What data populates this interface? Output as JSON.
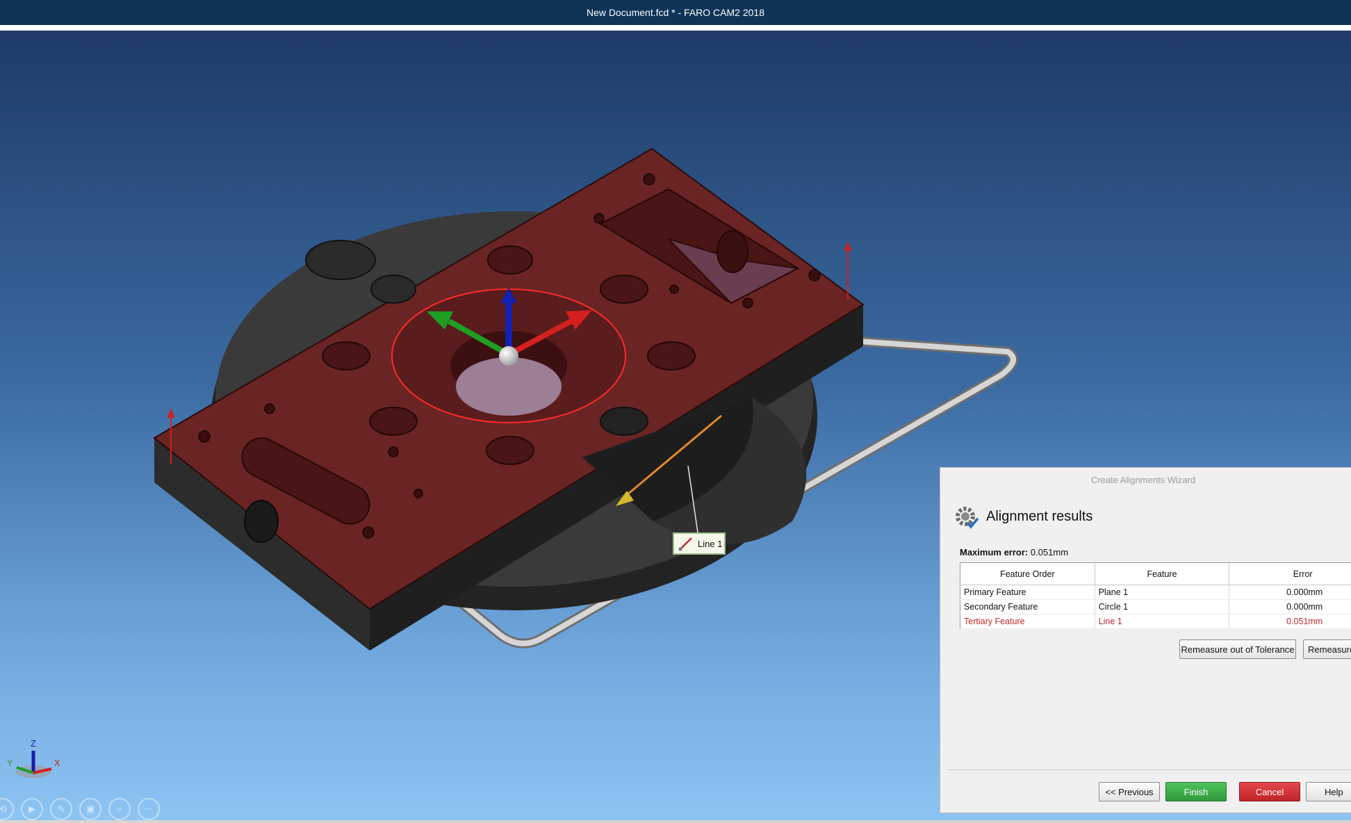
{
  "window": {
    "title": "New Document.fcd * - FARO CAM2 2018"
  },
  "viewport": {
    "feature_callout": {
      "label": "Line 1",
      "icon": "line-feature-icon"
    },
    "axis_triad": {
      "z": "Z",
      "y": "Y",
      "x": "X"
    },
    "toolbar_icons": [
      "rotate-icon",
      "play-icon",
      "measure-icon",
      "fit-view-icon",
      "zoom-icon",
      "more-icon"
    ]
  },
  "wizard": {
    "title": "Create Alignments Wizard",
    "heading": "Alignment results",
    "icon": "gear-check-icon",
    "max_error_label": "Maximum error:",
    "max_error_value": "0.051mm",
    "table": {
      "columns": [
        "Feature Order",
        "Feature",
        "Error"
      ],
      "rows": [
        {
          "order": "Primary Feature",
          "feature": "Plane 1",
          "error": "0.000mm"
        },
        {
          "order": "Secondary Feature",
          "feature": "Circle 1",
          "error": "0.000mm"
        },
        {
          "order": "Tertiary Feature",
          "feature": "Line 1",
          "error": "0.051mm"
        }
      ]
    },
    "buttons": {
      "remeasure_oot": "Remeasure out of Tolerance",
      "remeasure": "Remeasure",
      "previous": "<< Previous",
      "finish": "Finish",
      "cancel": "Cancel",
      "help": "Help"
    }
  },
  "colors": {
    "title_bar": "#0e3458",
    "finish": "#2f9a3a",
    "cancel": "#c02429",
    "out_of_tolerance": "#c0282d"
  }
}
